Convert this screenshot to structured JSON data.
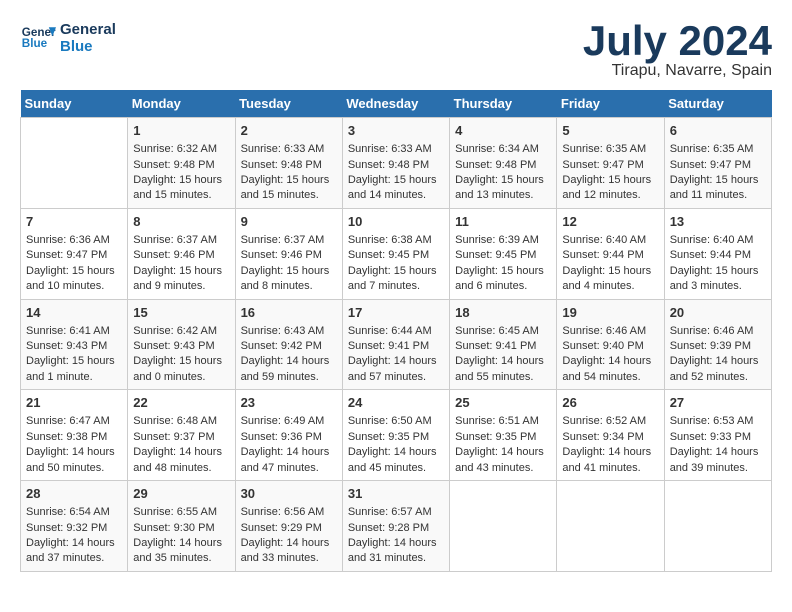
{
  "logo": {
    "line1": "General",
    "line2": "Blue"
  },
  "title": "July 2024",
  "location": "Tirapu, Navarre, Spain",
  "days_of_week": [
    "Sunday",
    "Monday",
    "Tuesday",
    "Wednesday",
    "Thursday",
    "Friday",
    "Saturday"
  ],
  "weeks": [
    [
      {
        "day": "",
        "lines": []
      },
      {
        "day": "1",
        "lines": [
          "Sunrise: 6:32 AM",
          "Sunset: 9:48 PM",
          "Daylight: 15 hours",
          "and 15 minutes."
        ]
      },
      {
        "day": "2",
        "lines": [
          "Sunrise: 6:33 AM",
          "Sunset: 9:48 PM",
          "Daylight: 15 hours",
          "and 15 minutes."
        ]
      },
      {
        "day": "3",
        "lines": [
          "Sunrise: 6:33 AM",
          "Sunset: 9:48 PM",
          "Daylight: 15 hours",
          "and 14 minutes."
        ]
      },
      {
        "day": "4",
        "lines": [
          "Sunrise: 6:34 AM",
          "Sunset: 9:48 PM",
          "Daylight: 15 hours",
          "and 13 minutes."
        ]
      },
      {
        "day": "5",
        "lines": [
          "Sunrise: 6:35 AM",
          "Sunset: 9:47 PM",
          "Daylight: 15 hours",
          "and 12 minutes."
        ]
      },
      {
        "day": "6",
        "lines": [
          "Sunrise: 6:35 AM",
          "Sunset: 9:47 PM",
          "Daylight: 15 hours",
          "and 11 minutes."
        ]
      }
    ],
    [
      {
        "day": "7",
        "lines": [
          "Sunrise: 6:36 AM",
          "Sunset: 9:47 PM",
          "Daylight: 15 hours",
          "and 10 minutes."
        ]
      },
      {
        "day": "8",
        "lines": [
          "Sunrise: 6:37 AM",
          "Sunset: 9:46 PM",
          "Daylight: 15 hours",
          "and 9 minutes."
        ]
      },
      {
        "day": "9",
        "lines": [
          "Sunrise: 6:37 AM",
          "Sunset: 9:46 PM",
          "Daylight: 15 hours",
          "and 8 minutes."
        ]
      },
      {
        "day": "10",
        "lines": [
          "Sunrise: 6:38 AM",
          "Sunset: 9:45 PM",
          "Daylight: 15 hours",
          "and 7 minutes."
        ]
      },
      {
        "day": "11",
        "lines": [
          "Sunrise: 6:39 AM",
          "Sunset: 9:45 PM",
          "Daylight: 15 hours",
          "and 6 minutes."
        ]
      },
      {
        "day": "12",
        "lines": [
          "Sunrise: 6:40 AM",
          "Sunset: 9:44 PM",
          "Daylight: 15 hours",
          "and 4 minutes."
        ]
      },
      {
        "day": "13",
        "lines": [
          "Sunrise: 6:40 AM",
          "Sunset: 9:44 PM",
          "Daylight: 15 hours",
          "and 3 minutes."
        ]
      }
    ],
    [
      {
        "day": "14",
        "lines": [
          "Sunrise: 6:41 AM",
          "Sunset: 9:43 PM",
          "Daylight: 15 hours",
          "and 1 minute."
        ]
      },
      {
        "day": "15",
        "lines": [
          "Sunrise: 6:42 AM",
          "Sunset: 9:43 PM",
          "Daylight: 15 hours",
          "and 0 minutes."
        ]
      },
      {
        "day": "16",
        "lines": [
          "Sunrise: 6:43 AM",
          "Sunset: 9:42 PM",
          "Daylight: 14 hours",
          "and 59 minutes."
        ]
      },
      {
        "day": "17",
        "lines": [
          "Sunrise: 6:44 AM",
          "Sunset: 9:41 PM",
          "Daylight: 14 hours",
          "and 57 minutes."
        ]
      },
      {
        "day": "18",
        "lines": [
          "Sunrise: 6:45 AM",
          "Sunset: 9:41 PM",
          "Daylight: 14 hours",
          "and 55 minutes."
        ]
      },
      {
        "day": "19",
        "lines": [
          "Sunrise: 6:46 AM",
          "Sunset: 9:40 PM",
          "Daylight: 14 hours",
          "and 54 minutes."
        ]
      },
      {
        "day": "20",
        "lines": [
          "Sunrise: 6:46 AM",
          "Sunset: 9:39 PM",
          "Daylight: 14 hours",
          "and 52 minutes."
        ]
      }
    ],
    [
      {
        "day": "21",
        "lines": [
          "Sunrise: 6:47 AM",
          "Sunset: 9:38 PM",
          "Daylight: 14 hours",
          "and 50 minutes."
        ]
      },
      {
        "day": "22",
        "lines": [
          "Sunrise: 6:48 AM",
          "Sunset: 9:37 PM",
          "Daylight: 14 hours",
          "and 48 minutes."
        ]
      },
      {
        "day": "23",
        "lines": [
          "Sunrise: 6:49 AM",
          "Sunset: 9:36 PM",
          "Daylight: 14 hours",
          "and 47 minutes."
        ]
      },
      {
        "day": "24",
        "lines": [
          "Sunrise: 6:50 AM",
          "Sunset: 9:35 PM",
          "Daylight: 14 hours",
          "and 45 minutes."
        ]
      },
      {
        "day": "25",
        "lines": [
          "Sunrise: 6:51 AM",
          "Sunset: 9:35 PM",
          "Daylight: 14 hours",
          "and 43 minutes."
        ]
      },
      {
        "day": "26",
        "lines": [
          "Sunrise: 6:52 AM",
          "Sunset: 9:34 PM",
          "Daylight: 14 hours",
          "and 41 minutes."
        ]
      },
      {
        "day": "27",
        "lines": [
          "Sunrise: 6:53 AM",
          "Sunset: 9:33 PM",
          "Daylight: 14 hours",
          "and 39 minutes."
        ]
      }
    ],
    [
      {
        "day": "28",
        "lines": [
          "Sunrise: 6:54 AM",
          "Sunset: 9:32 PM",
          "Daylight: 14 hours",
          "and 37 minutes."
        ]
      },
      {
        "day": "29",
        "lines": [
          "Sunrise: 6:55 AM",
          "Sunset: 9:30 PM",
          "Daylight: 14 hours",
          "and 35 minutes."
        ]
      },
      {
        "day": "30",
        "lines": [
          "Sunrise: 6:56 AM",
          "Sunset: 9:29 PM",
          "Daylight: 14 hours",
          "and 33 minutes."
        ]
      },
      {
        "day": "31",
        "lines": [
          "Sunrise: 6:57 AM",
          "Sunset: 9:28 PM",
          "Daylight: 14 hours",
          "and 31 minutes."
        ]
      },
      {
        "day": "",
        "lines": []
      },
      {
        "day": "",
        "lines": []
      },
      {
        "day": "",
        "lines": []
      }
    ]
  ]
}
